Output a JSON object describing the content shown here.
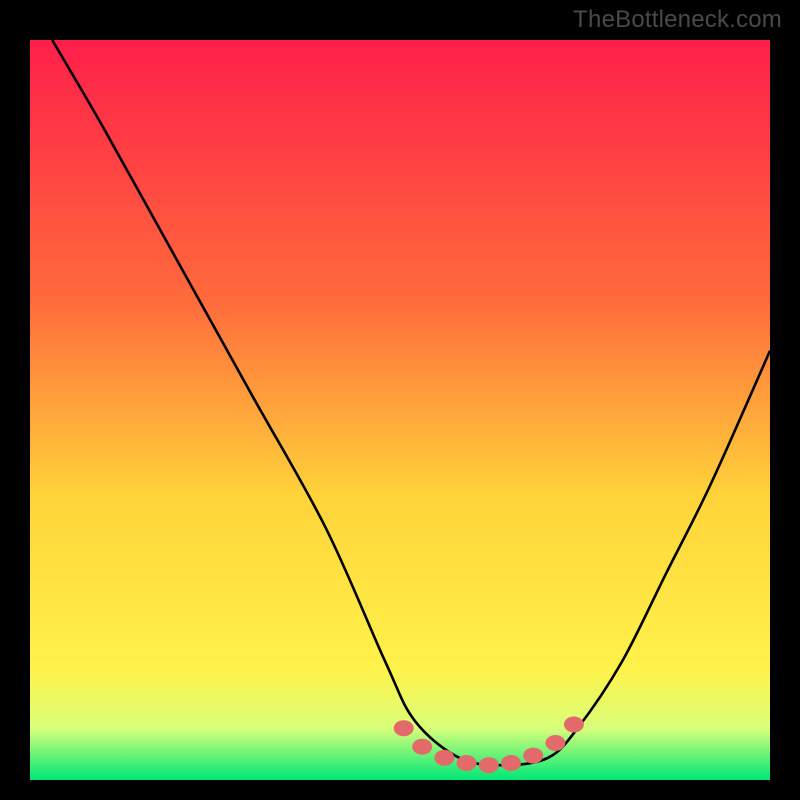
{
  "attribution": "TheBottleneck.com",
  "colors": {
    "frame": "#000000",
    "gradient_top": "#ff1f4a",
    "gradient_mid1": "#ff6a3c",
    "gradient_mid2": "#ffd43a",
    "gradient_mid3": "#fff24a",
    "gradient_bottom": "#00e776",
    "curve": "#000000",
    "marker": "#e36a6a"
  },
  "chart_data": {
    "type": "line",
    "title": "",
    "xlabel": "",
    "ylabel": "",
    "xlim": [
      0,
      100
    ],
    "ylim": [
      0,
      100
    ],
    "grid": false,
    "legend": false,
    "series": [
      {
        "name": "bottleneck-curve",
        "x": [
          3,
          10,
          20,
          30,
          40,
          48,
          52,
          58,
          64,
          70,
          74,
          80,
          86,
          92,
          100
        ],
        "y": [
          100,
          88,
          70,
          52,
          34,
          16,
          8,
          3,
          2,
          3,
          7,
          16,
          28,
          40,
          58
        ]
      }
    ],
    "markers": {
      "name": "optimal-range",
      "x": [
        50.5,
        53,
        56,
        59,
        62,
        65,
        68,
        71,
        73.5
      ],
      "y": [
        7.0,
        4.5,
        3.0,
        2.3,
        2.0,
        2.3,
        3.3,
        5.0,
        7.5
      ]
    }
  }
}
